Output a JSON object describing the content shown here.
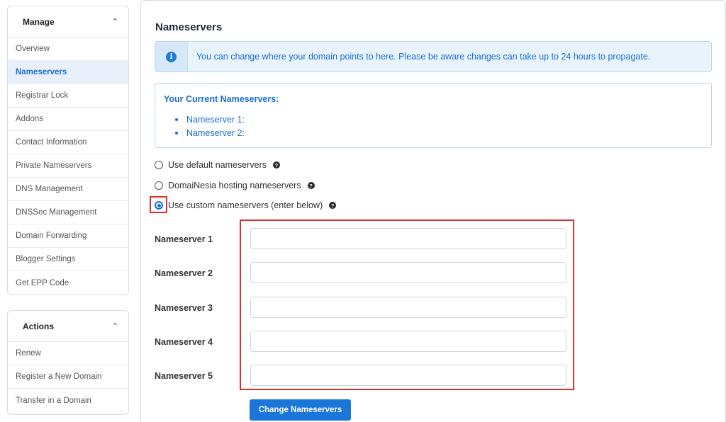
{
  "sidebar": {
    "manage": {
      "title": "Manage",
      "items": [
        {
          "label": "Overview"
        },
        {
          "label": "Nameservers",
          "active": true
        },
        {
          "label": "Registrar Lock"
        },
        {
          "label": "Addons"
        },
        {
          "label": "Contact Information"
        },
        {
          "label": "Private Nameservers"
        },
        {
          "label": "DNS Management"
        },
        {
          "label": "DNSSec Management"
        },
        {
          "label": "Domain Forwarding"
        },
        {
          "label": "Blogger Settings"
        },
        {
          "label": "Get EPP Code"
        }
      ]
    },
    "actions": {
      "title": "Actions",
      "items": [
        {
          "label": "Renew"
        },
        {
          "label": "Register a New Domain"
        },
        {
          "label": "Transfer in a Domain"
        }
      ]
    }
  },
  "main": {
    "title": "Nameservers",
    "info_message": "You can change where your domain points to here. Please be aware changes can take up to 24 hours to propagate.",
    "current": {
      "heading": "Your Current Nameservers:",
      "items": [
        "Nameserver 1:",
        "Nameserver 2:"
      ]
    },
    "options": [
      {
        "label": "Use default nameservers",
        "checked": false
      },
      {
        "label": "DomaiNesia hosting nameservers",
        "checked": false
      },
      {
        "label": "Use custom nameservers (enter below)",
        "checked": true
      }
    ],
    "fields": [
      {
        "label": "Nameserver 1",
        "value": ""
      },
      {
        "label": "Nameserver 2",
        "value": ""
      },
      {
        "label": "Nameserver 3",
        "value": ""
      },
      {
        "label": "Nameserver 4",
        "value": ""
      },
      {
        "label": "Nameserver 5",
        "value": ""
      }
    ],
    "submit_label": "Change Nameservers"
  },
  "colors": {
    "accent": "#1a76d8",
    "link": "#1a6fd1",
    "highlight": "#d93030"
  }
}
